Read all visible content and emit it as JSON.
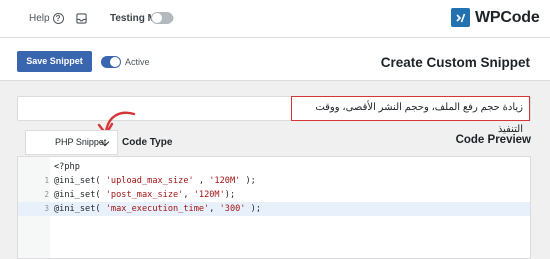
{
  "topbar": {
    "help_label": "Help",
    "help_icon": "question-circle-icon",
    "inbox_icon": "inbox-icon",
    "testing_mode_label": "Testing Mode",
    "logo_text": "WPCode"
  },
  "actionbar": {
    "save_label": "Save Snippet",
    "active_label": "Active",
    "page_title": "Create Custom Snippet"
  },
  "snippet": {
    "title_value": "زيادة حجم رفع الملف، وحجم النشر الأقصى، ووقت التنفيذ"
  },
  "code": {
    "type_selected": "PHP Snippet",
    "type_label": "Code Type",
    "preview_label": "Code Preview",
    "header": "<?php",
    "lines": [
      {
        "num": "1",
        "fn": "@ini_set( ",
        "arg1": "'upload_max_size'",
        "sep": " , ",
        "arg2": "'120M'",
        "end": " );"
      },
      {
        "num": "2",
        "fn": "@ini_set( ",
        "arg1": "'post_max_size'",
        "sep": ", ",
        "arg2": "'120M'",
        "end": ");"
      },
      {
        "num": "3",
        "fn": "@ini_set( ",
        "arg1": "'max_execution_time'",
        "sep": ", ",
        "arg2": "'300'",
        "end": " );"
      }
    ]
  },
  "colors": {
    "accent": "#3a66b0",
    "highlight_border": "#d63638",
    "arrow": "#d63638"
  }
}
